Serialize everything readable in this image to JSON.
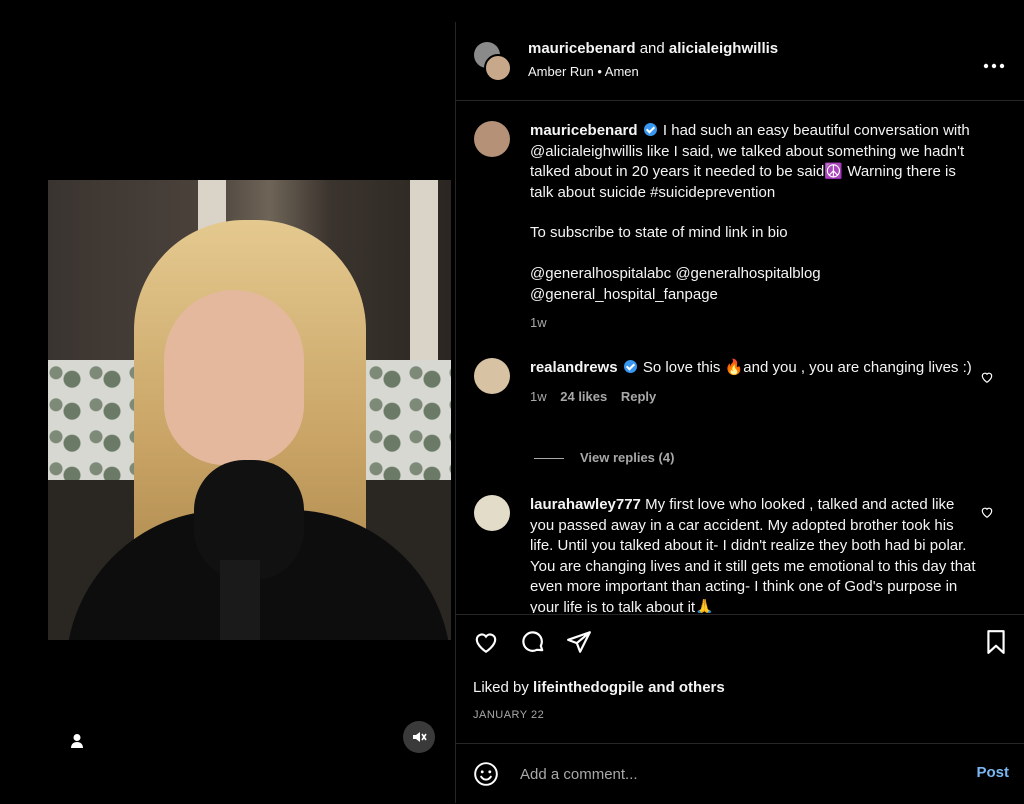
{
  "media": {
    "user_icon": "person-icon",
    "mute_icon": "speaker-muted-icon"
  },
  "header": {
    "user1": "mauricebenard",
    "joiner": "and",
    "user2": "alicialeighwillis",
    "audio": "Amber Run • Amen",
    "more_icon": "more-horizontal-icon"
  },
  "caption": {
    "username": "mauricebenard",
    "verified": true,
    "line1": "I had such an easy beautiful conversation with @alicialeighwillis like I said, we talked about something we hadn't talked about in 20 years it needed to be said☮️ Warning there is talk about suicide #suicideprevention",
    "line2": "To subscribe to state of mind link in bio",
    "line3": "@generalhospitalabc @generalhospitalblog @general_hospital_fanpage",
    "time": "1w"
  },
  "comment1": {
    "username": "realandrews",
    "verified": true,
    "text": "So love this 🔥and you , you are changing lives :)",
    "time": "1w",
    "likes": "24 likes",
    "reply": "Reply",
    "view_replies": "View replies (4)"
  },
  "comment2": {
    "username": "laurahawley777",
    "text": "My first love who looked , talked and acted like you passed away in a car accident. My adopted brother took his life. Until you talked about it- I didn't realize they both had bi polar. You are changing lives and it still gets me emotional to this day that even more important than acting- I think one of God's purpose in your life is to talk about it🙏"
  },
  "actions": {
    "like_icon": "heart-icon",
    "comment_icon": "comment-bubble-icon",
    "share_icon": "paper-plane-icon",
    "save_icon": "bookmark-icon",
    "liked_by_prefix": "Liked by",
    "liked_by_user": "lifeinthedogpile",
    "liked_by_suffix": "and others",
    "date": "JANUARY 22"
  },
  "add_comment": {
    "placeholder": "Add a comment...",
    "post_label": "Post",
    "emoji_icon": "smiley-icon"
  },
  "colors": {
    "background": "#000000",
    "text": "#f5f5f5",
    "muted": "#a8a8a8",
    "verified": "#3897f0",
    "post": "#7ab8f2"
  }
}
